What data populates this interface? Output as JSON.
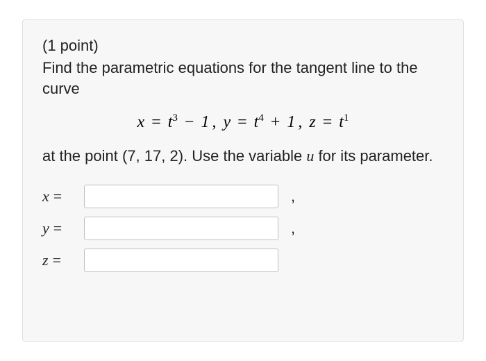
{
  "heading": "(1 point)",
  "prompt": "Find the parametric equations for the tangent line to the curve",
  "equation": {
    "x_var": "x",
    "x_rhs_base": "t",
    "x_rhs_exp": "3",
    "x_rhs_const": "1",
    "y_var": "y",
    "y_rhs_base": "t",
    "y_rhs_exp": "4",
    "y_rhs_const": "1",
    "z_var": "z",
    "z_rhs_base": "t",
    "z_rhs_exp": "1"
  },
  "post_text_1": "at the point (7, 17, 2). Use the variable ",
  "param_var": "u",
  "post_text_2": " for its parameter.",
  "answers": {
    "x_label": "x",
    "y_label": "y",
    "z_label": "z",
    "eq": "=",
    "x_value": "",
    "y_value": "",
    "z_value": "",
    "comma": ","
  }
}
